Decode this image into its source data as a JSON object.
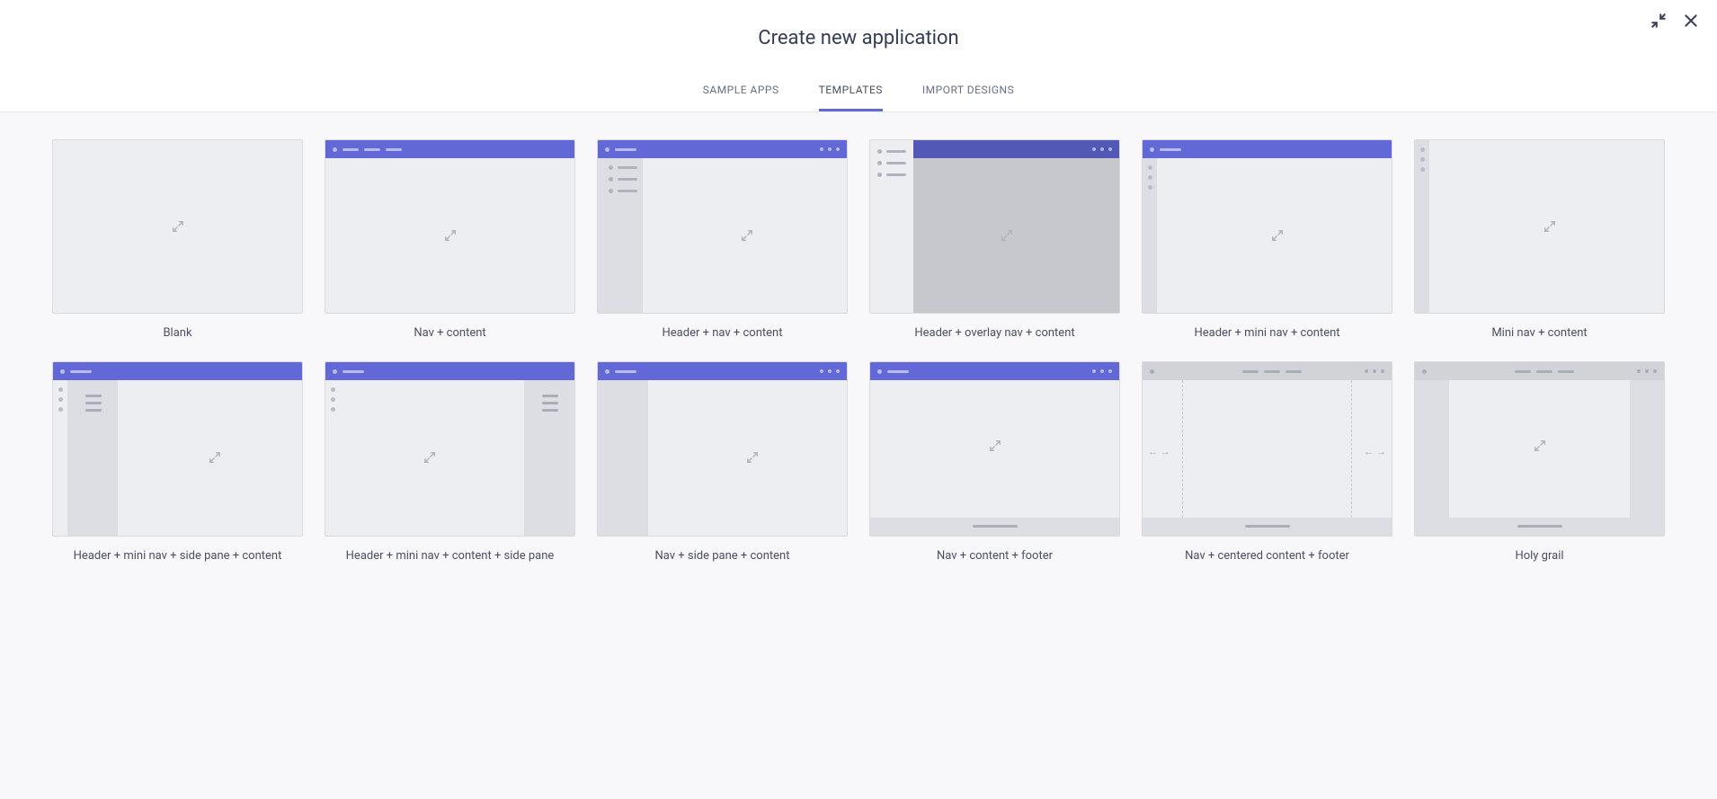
{
  "dialog": {
    "title": "Create new application"
  },
  "tabs": {
    "sample": "SAMPLE APPS",
    "templates": "TEMPLATES",
    "import": "IMPORT DESIGNS"
  },
  "templates": [
    {
      "label": "Blank"
    },
    {
      "label": "Nav + content"
    },
    {
      "label": "Header + nav + content"
    },
    {
      "label": "Header + overlay nav + content"
    },
    {
      "label": "Header + mini nav + content"
    },
    {
      "label": "Mini nav + content"
    },
    {
      "label": "Header + mini nav + side pane + content"
    },
    {
      "label": "Header + mini nav + content + side pane"
    },
    {
      "label": "Nav + side pane + content"
    },
    {
      "label": "Nav + content + footer"
    },
    {
      "label": "Nav + centered content + footer"
    },
    {
      "label": "Holy grail"
    }
  ]
}
